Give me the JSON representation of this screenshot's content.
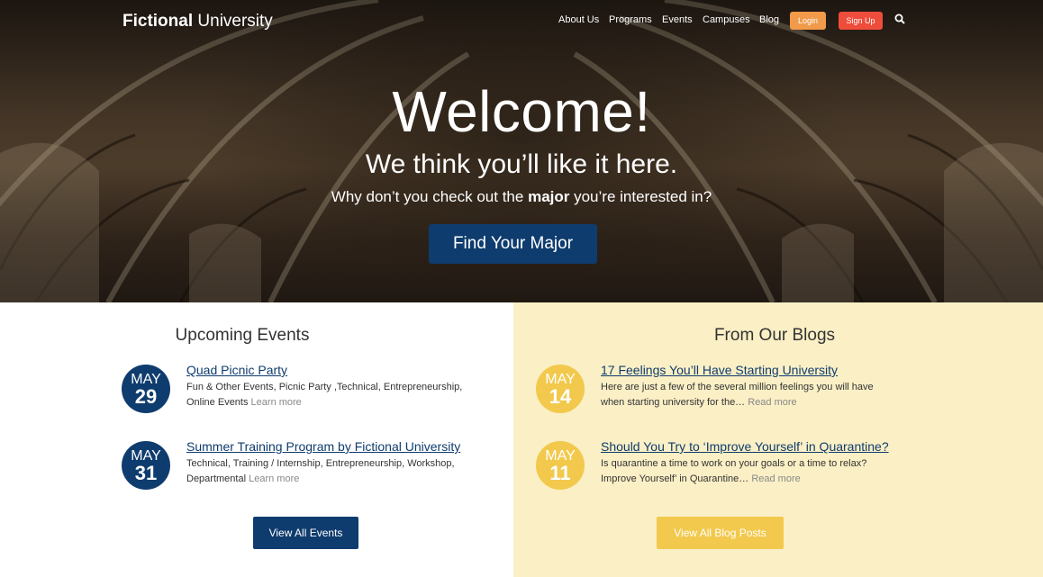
{
  "header": {
    "logo_bold": "Fictional",
    "logo_light": " University",
    "nav": [
      "About Us",
      "Programs",
      "Events",
      "Campuses",
      "Blog"
    ],
    "login_label": "Login",
    "signup_label": "Sign Up",
    "search_icon": "search-icon"
  },
  "hero": {
    "title": "Welcome!",
    "subtitle": "We think you’ll like it here.",
    "tagline_before": "Why don’t you check out the ",
    "tagline_bold": "major",
    "tagline_after": " you’re interested in?",
    "cta_label": "Find Your Major"
  },
  "events": {
    "heading": "Upcoming Events",
    "items": [
      {
        "month": "MAY",
        "day": "29",
        "title": "Quad Picnic Party",
        "desc": "Fun & Other Events, Picnic Party ,Technical, Entrepreneurship, Online Events ",
        "more": "Learn more"
      },
      {
        "month": "MAY",
        "day": "31",
        "title": "Summer Training Program by Fictional University",
        "desc": "Technical, Training / Internship, Entrepreneurship, Workshop, Departmental ",
        "more": "Learn more"
      }
    ],
    "view_all": "View All Events"
  },
  "blogs": {
    "heading": "From Our Blogs",
    "items": [
      {
        "month": "MAY",
        "day": "14",
        "title": "17 Feelings You’ll Have Starting University",
        "desc": "Here are just a few of the several million feelings you will have when starting university for the… ",
        "more": "Read more"
      },
      {
        "month": "MAY",
        "day": "11",
        "title": "Should You Try to ‘Improve Yourself’ in Quarantine?",
        "desc": "Is quarantine a time to work on your goals or a time to relax? Improve Yourself’ in Quarantine… ",
        "more": "Read more"
      }
    ],
    "view_all": "View All Blog Posts"
  },
  "colors": {
    "navy": "#0f3c6e",
    "yellow": "#f2c94c",
    "cream": "#faefc5",
    "login_orange": "#f09a4a",
    "signup_red": "#ef4d3b"
  }
}
